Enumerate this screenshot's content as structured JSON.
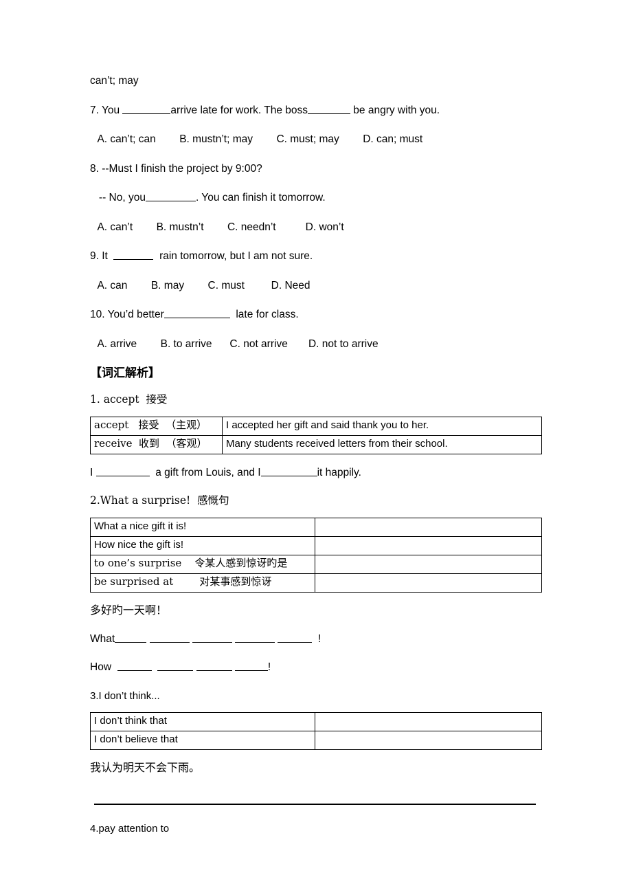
{
  "document": {
    "type": "worksheet",
    "language": "en-zh"
  },
  "top_fragment": "can’t; may",
  "questions": [
    {
      "id": "q7",
      "stem_before": "7. You ",
      "blank1_width": 70,
      "stem_middle": "arrive late for work. The boss",
      "blank2_width": 62,
      "stem_after": " be angry with you.",
      "options_line": " A. can’t; can        B. mustn’t; may        C. must; may        D. can; must"
    },
    {
      "id": "q8",
      "stem_line1": "8. --Must I finish the project by 9:00?",
      "stem_line2_before": "   -- No, you",
      "blank1_width": 73,
      "stem_line2_after": ". You can finish it tomorrow.",
      "options_line": " A. can’t        B. mustn’t        C. needn’t          D. won’t"
    },
    {
      "id": "q9",
      "stem_before": "9. It  ",
      "blank1_width": 58,
      "stem_after": "  rain tomorrow, but I am not sure.",
      "options_line": " A. can        B. may        C. must         D. Need"
    },
    {
      "id": "q10",
      "stem_before": "10. You’d better",
      "blank1_width": 96,
      "stem_after": "  late for class.",
      "options_line": " A. arrive        B. to arrive      C. not arrive       D. not to arrive"
    }
  ],
  "section_heading": "【词汇解析】",
  "entries": [
    {
      "id": "entry-1",
      "heading": "1. accept  接受",
      "table": {
        "rows": [
          {
            "left": "accept   接受  （主观）",
            "right": "I accepted her gift and said thank you to her."
          },
          {
            "left": "receive  收到  （客观）",
            "right": "Many students received letters from their school."
          }
        ]
      },
      "practice": {
        "before": "I ",
        "blank1_width": 78,
        "middle": "  a gift from Louis, and I",
        "blank2_width": 82,
        "after": "it happily."
      }
    },
    {
      "id": "entry-2",
      "heading": "2.What a surprise!  感慨句",
      "table": {
        "rows": [
          {
            "left": "What a nice gift it is!",
            "right": ""
          },
          {
            "left": "How nice the gift is!",
            "right": ""
          },
          {
            "left": "to one’s surprise    令某人感到惊讶旳是",
            "right": ""
          },
          {
            "left": "be surprised at        对某事感到惊讶",
            "right": ""
          }
        ]
      },
      "cn_prompt": "多好旳一天啊！",
      "fill_lines": [
        {
          "label": "What",
          "blanks": [
            46,
            58,
            58,
            58,
            50
          ],
          "suffix": "  !"
        },
        {
          "label": "How ",
          "blanks": [
            50,
            52,
            52,
            48
          ],
          "suffix": "!"
        }
      ]
    },
    {
      "id": "entry-3",
      "heading": "3.I don’t think...",
      "table": {
        "rows": [
          {
            "left": "I don’t think that",
            "right": ""
          },
          {
            "left": "I don’t believe that",
            "right": ""
          }
        ]
      },
      "cn_prompt": "我认为明天不会下雨。"
    },
    {
      "id": "entry-4",
      "heading": "4.pay attention to"
    }
  ],
  "colors": {
    "text": "#000000",
    "page_background": "#ffffff",
    "table_border": "#000000",
    "rule": "#000000"
  }
}
